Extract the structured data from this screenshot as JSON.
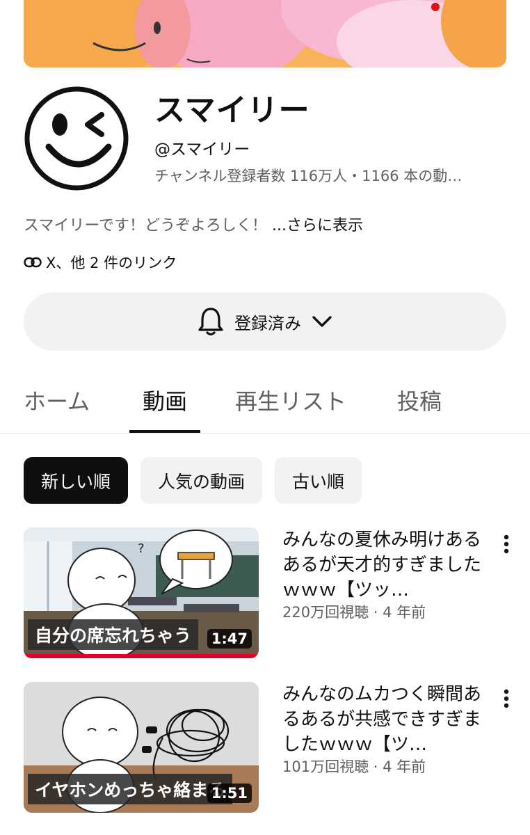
{
  "channel": {
    "name": "スマイリー",
    "handle": "@スマイリー",
    "stats": "チャンネル登録者数 116万人・1166 本の動…",
    "description": "スマイリーです！どうぞよろしく！",
    "description_more": "...さらに表示",
    "links_text": "X、他 2 件のリンク"
  },
  "subscribe": {
    "label": "登録済み",
    "icon": "bell-icon"
  },
  "tabs": [
    {
      "label": "ホーム"
    },
    {
      "label": "動画",
      "active": true
    },
    {
      "label": "再生リスト"
    },
    {
      "label": "投稿"
    }
  ],
  "chips": [
    {
      "label": "新しい順",
      "active": true
    },
    {
      "label": "人気の動画"
    },
    {
      "label": "古い順"
    }
  ],
  "videos": [
    {
      "title": "みんなの夏休み明けあるあるが天才的すぎましたｗｗｗ【ツッ…",
      "meta": "220万回視聴 · 4 年前",
      "duration": "1:47",
      "thumb_caption": "自分の席忘れちゃう"
    },
    {
      "title": "みんなのムカつく瞬間あるあるが共感できすぎましたｗｗｗ【ツ…",
      "meta": "101万回視聴 · 4 年前",
      "duration": "1:51",
      "thumb_caption": "イヤホンめっちゃ絡まる"
    }
  ],
  "colors": {
    "accent_red": "#e0002a",
    "chip_active_bg": "#0f0f0f",
    "secondary_text": "#606060"
  }
}
